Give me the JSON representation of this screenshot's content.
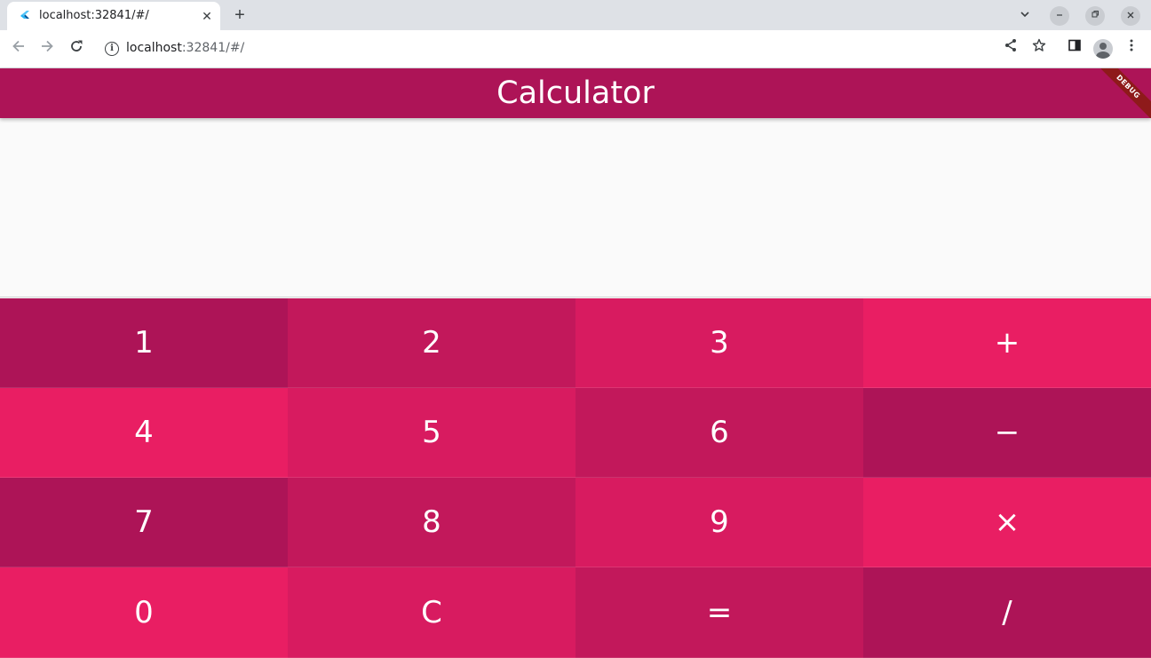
{
  "browser": {
    "tab_title": "localhost:32841/#/",
    "tab_close": "✕",
    "new_tab": "+",
    "url_host": "localhost",
    "url_rest": ":32841/#/"
  },
  "app": {
    "title": "Calculator",
    "debug_banner": "DEBUG",
    "display_value": ""
  },
  "colors": {
    "appbar": "#ad1457",
    "key_shade_1": "#ad1457",
    "key_shade_2": "#c2185b",
    "key_shade_3": "#d81b60",
    "key_shade_4": "#e91e63"
  },
  "keys": [
    {
      "label": "1",
      "color": "#ad1457"
    },
    {
      "label": "2",
      "color": "#c2185b"
    },
    {
      "label": "3",
      "color": "#d81b60"
    },
    {
      "label": "+",
      "color": "#e91e63"
    },
    {
      "label": "4",
      "color": "#e91e63"
    },
    {
      "label": "5",
      "color": "#d81b60"
    },
    {
      "label": "6",
      "color": "#c2185b"
    },
    {
      "label": "−",
      "color": "#ad1457"
    },
    {
      "label": "7",
      "color": "#ad1457"
    },
    {
      "label": "8",
      "color": "#c2185b"
    },
    {
      "label": "9",
      "color": "#d81b60"
    },
    {
      "label": "×",
      "color": "#e91e63"
    },
    {
      "label": "0",
      "color": "#e91e63"
    },
    {
      "label": "C",
      "color": "#d81b60"
    },
    {
      "label": "=",
      "color": "#c2185b"
    },
    {
      "label": "/",
      "color": "#ad1457"
    }
  ]
}
